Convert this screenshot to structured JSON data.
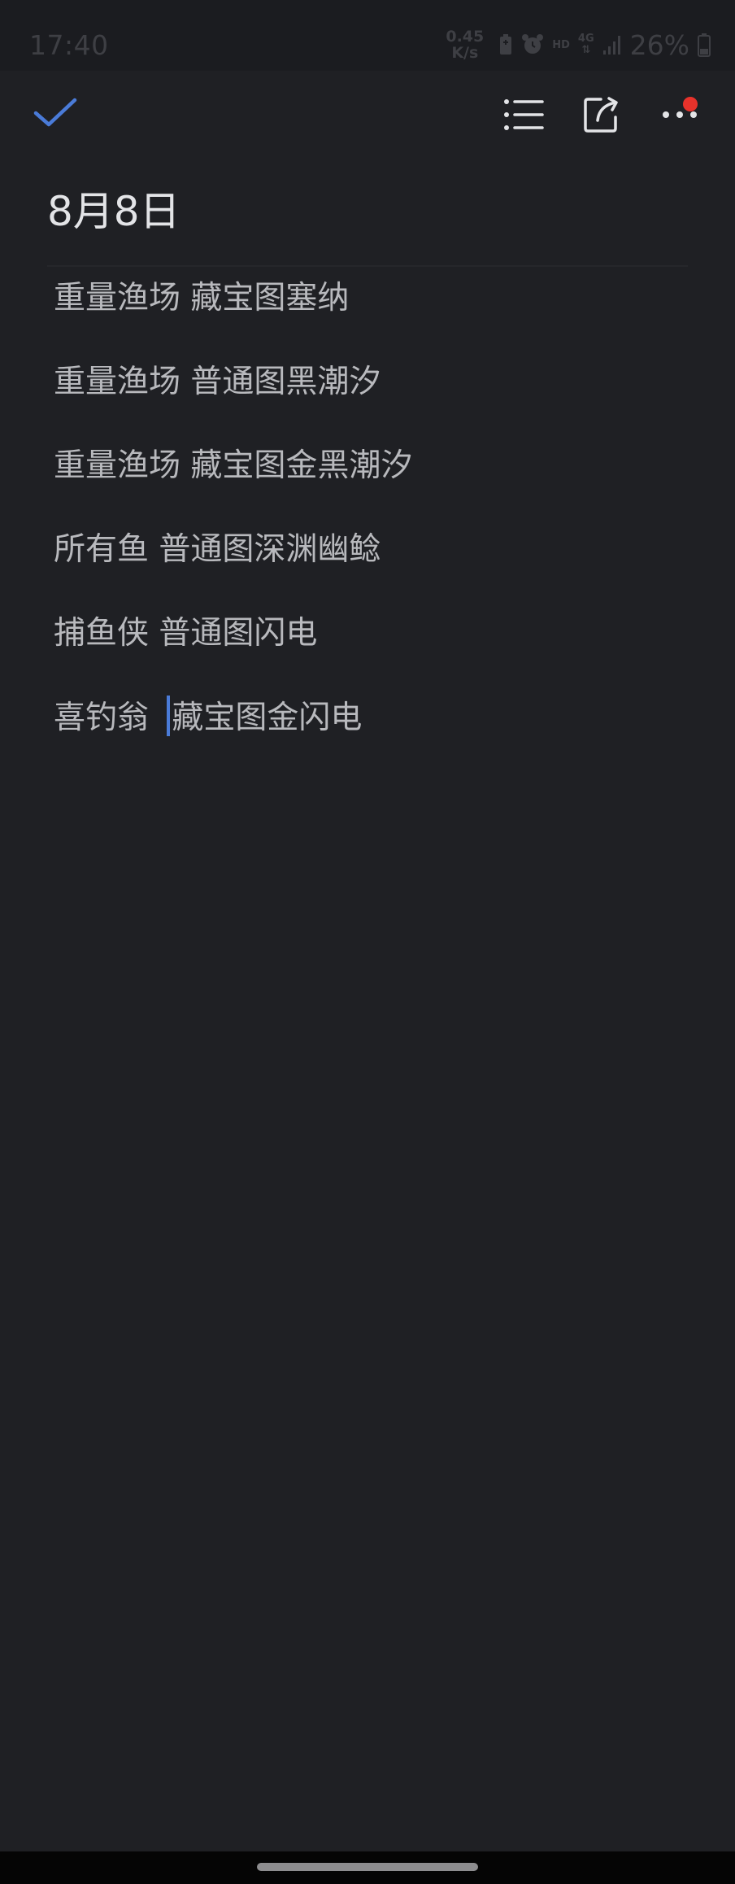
{
  "status_bar": {
    "time": "17:40",
    "net_speed_value": "0.45",
    "net_speed_unit": "K/s",
    "hd_label": "HD",
    "network_type": "4G",
    "battery_percent": "26%"
  },
  "toolbar": {
    "confirm_icon": "check-icon",
    "list_icon": "list-icon",
    "share_icon": "share-icon",
    "more_icon": "more-dots-icon",
    "accent_color": "#4a7bd8",
    "notification_color": "#e8322b"
  },
  "note": {
    "title": "8月8日",
    "lines": [
      "重量渔场 藏宝图塞纳",
      "重量渔场 普通图黑潮汐",
      "重量渔场 藏宝图金黑潮汐",
      "所有鱼 普通图深渊幽鲶",
      "捕鱼侠 普通图闪电"
    ],
    "last_line_before_cursor": "喜钓翁 ",
    "last_line_after_cursor": "藏宝图金闪电"
  }
}
